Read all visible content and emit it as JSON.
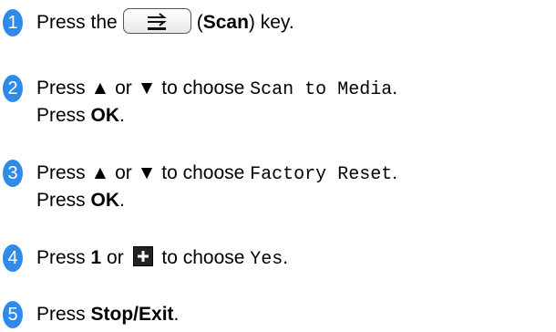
{
  "accent_color": "#2f8ae8",
  "steps": [
    {
      "number": "1",
      "pre": "Press the",
      "key_icon": "scan-icon",
      "paren_open": "(",
      "key_name": "Scan",
      "post": ") key."
    },
    {
      "number": "2",
      "pre": "Press ▲ or ▼ to choose ",
      "mono": "Scan to Media",
      "post": ".",
      "press": "Press ",
      "ok": "OK",
      "end": "."
    },
    {
      "number": "3",
      "pre": "Press ▲ or ▼ to choose ",
      "mono": "Factory Reset",
      "post": ".",
      "press": "Press ",
      "ok": "OK",
      "end": "."
    },
    {
      "number": "4",
      "pre": "Press ",
      "bold1": "1",
      "mid": " or ",
      "key_icon": "plus-key-icon",
      "post": " to choose ",
      "mono": "Yes",
      "end": "."
    },
    {
      "number": "5",
      "pre": "Press ",
      "bold": "Stop/Exit",
      "end": "."
    }
  ]
}
